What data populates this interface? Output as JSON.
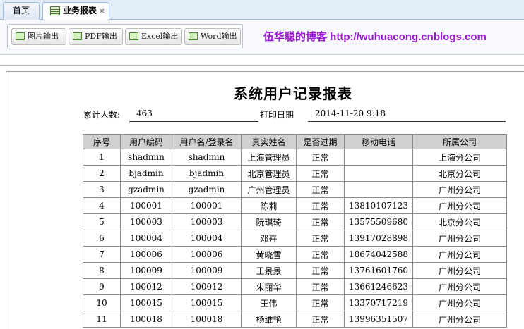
{
  "tabs": [
    {
      "label": "首页"
    },
    {
      "label": "业务报表",
      "close": "×"
    }
  ],
  "toolbar": {
    "buttons": [
      {
        "label": "图片输出"
      },
      {
        "label": "PDF输出"
      },
      {
        "label": "Excel输出"
      },
      {
        "label": "Word输出"
      }
    ],
    "blog_text": "伍华聪的博客 http://wuhuacong.cnblogs.com"
  },
  "report": {
    "title": "系统用户记录报表",
    "count_label": "累计人数:",
    "count_value": "463",
    "print_label": "打印日期",
    "print_value": "2014-11-20 9:18",
    "columns": [
      "序号",
      "用户编码",
      "用户名/登录名",
      "真实姓名",
      "是否过期",
      "移动电话",
      "所属公司"
    ],
    "rows": [
      [
        "1",
        "shadmin",
        "shadmin",
        "上海管理员",
        "正常",
        "",
        "上海分公司"
      ],
      [
        "2",
        "bjadmin",
        "bjadmin",
        "北京管理员",
        "正常",
        "",
        "北京分公司"
      ],
      [
        "3",
        "gzadmin",
        "gzadmin",
        "广州管理员",
        "正常",
        "",
        "广州分公司"
      ],
      [
        "4",
        "100001",
        "100001",
        "陈莉",
        "正常",
        "13810107123",
        "广州分公司"
      ],
      [
        "5",
        "100003",
        "100003",
        "阮琪琦",
        "正常",
        "13575509680",
        "北京分公司"
      ],
      [
        "6",
        "100004",
        "100004",
        "邓卉",
        "正常",
        "13917028898",
        "广州分公司"
      ],
      [
        "7",
        "100006",
        "100006",
        "黄晓雪",
        "正常",
        "18674042588",
        "广州分公司"
      ],
      [
        "8",
        "100009",
        "100009",
        "王景景",
        "正常",
        "13761601760",
        "广州分公司"
      ],
      [
        "9",
        "100012",
        "100012",
        "朱丽华",
        "正常",
        "13661246623",
        "广州分公司"
      ],
      [
        "10",
        "100015",
        "100015",
        "王伟",
        "正常",
        "13370717219",
        "广州分公司"
      ],
      [
        "11",
        "100018",
        "100018",
        "杨维艳",
        "正常",
        "13996351507",
        "广州分公司"
      ]
    ]
  }
}
